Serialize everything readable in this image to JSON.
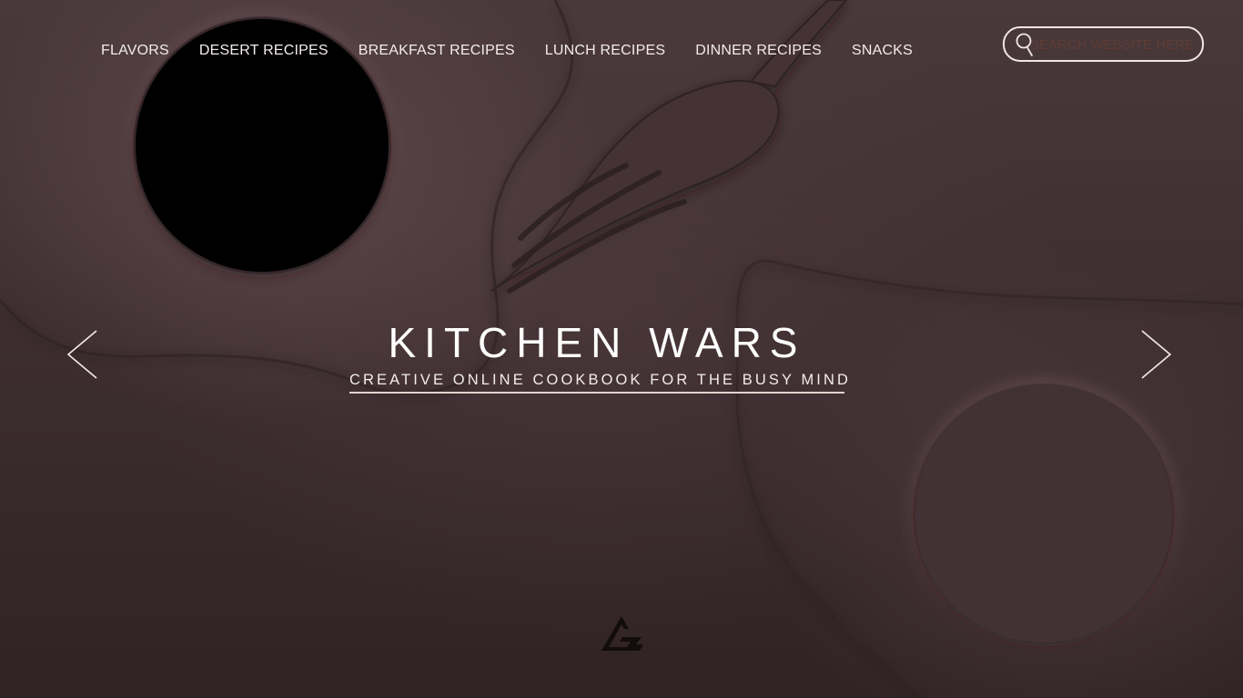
{
  "nav": {
    "items": [
      {
        "label": "FLAVORS"
      },
      {
        "label": "DESERT RECIPES"
      },
      {
        "label": "BREAKFAST RECIPES"
      },
      {
        "label": "LUNCH RECIPES"
      },
      {
        "label": "DINNER RECIPES"
      },
      {
        "label": "SNACKS"
      }
    ]
  },
  "search": {
    "placeholder": "SEARCH WEBSITE HERE",
    "icon": "search-icon"
  },
  "hero": {
    "title": "KITCHEN WARS",
    "subtitle": "CREATIVE ONLINE COOKBOOK FOR THE BUSY MIND",
    "prev_icon": "chevron-left-icon",
    "next_icon": "chevron-right-icon"
  },
  "footer": {
    "logo_icon": "triangle-logo-icon"
  },
  "colors": {
    "background": "#3f2f31",
    "text": "#ffffff",
    "search_placeholder": "#5e3c35",
    "accent_line": "#e2d3cf"
  }
}
